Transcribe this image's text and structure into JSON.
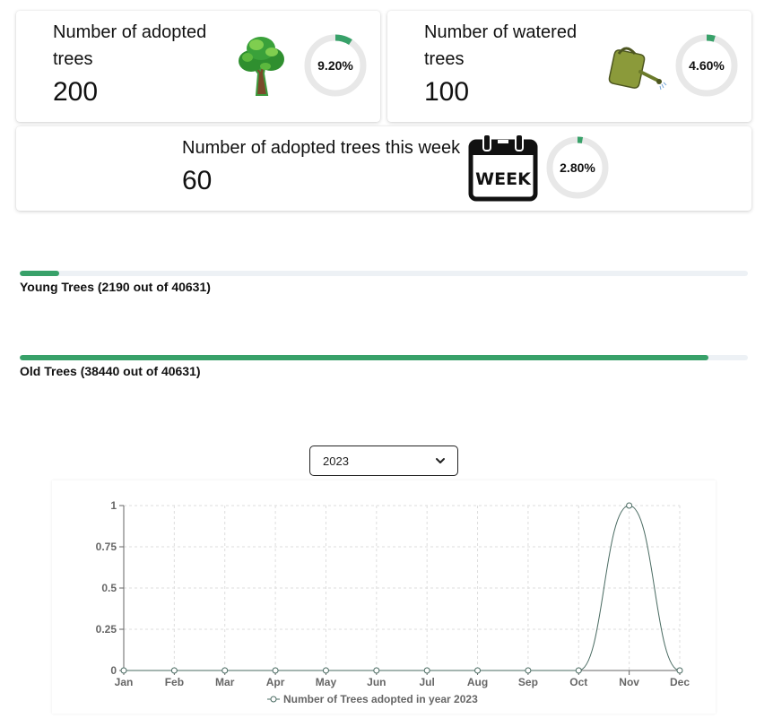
{
  "stats": {
    "adopted": {
      "title_line1": "Number of adopted",
      "title_line2": "trees",
      "value": "200",
      "percent_label": "9.20%",
      "percent": 0.092,
      "icon": "tree-icon"
    },
    "watered": {
      "title_line1": "Number of watered",
      "title_line2": "trees",
      "value": "100",
      "percent_label": "4.60%",
      "percent": 0.046,
      "icon": "watering-can-icon"
    },
    "week": {
      "title": "Number of adopted trees this week",
      "value": "60",
      "percent_label": "2.80%",
      "percent": 0.028,
      "icon": "calendar-week-icon",
      "icon_text": "WEEK"
    }
  },
  "progress": {
    "young": {
      "label": "Young Trees (2190 out of 40631)",
      "fraction": 0.0539
    },
    "old": {
      "label": "Old Trees (38440 out of 40631)",
      "fraction": 0.946
    }
  },
  "colors": {
    "accent": "#38a169",
    "track": "#edf1f5",
    "ring_track": "#e8e8e8",
    "line": "#4a6b62",
    "grid": "#dddddd"
  },
  "year_select": {
    "selected": "2023"
  },
  "chart_data": {
    "type": "line",
    "categories": [
      "Jan",
      "Feb",
      "Mar",
      "Apr",
      "May",
      "Jun",
      "Jul",
      "Aug",
      "Sep",
      "Oct",
      "Nov",
      "Dec"
    ],
    "series": [
      {
        "name": "Number of Trees adopted in year 2023",
        "values": [
          0,
          0,
          0,
          0,
          0,
          0,
          0,
          0,
          0,
          0,
          1,
          0
        ]
      }
    ],
    "yticks": [
      "0",
      "0.25",
      "0.5",
      "0.75",
      "1"
    ],
    "ylim": [
      0,
      1
    ],
    "grid": true,
    "legend": "bottom"
  }
}
